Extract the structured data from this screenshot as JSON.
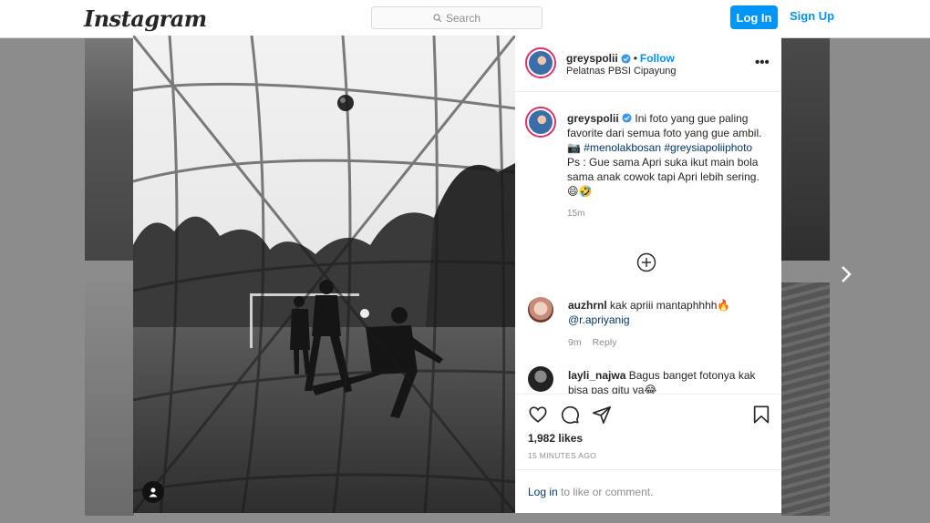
{
  "nav": {
    "logo": "Instagram",
    "search_placeholder": "Search",
    "login_label": "Log In",
    "signup_label": "Sign Up"
  },
  "post": {
    "username": "greyspolii",
    "follow_label": "Follow",
    "separator": "•",
    "location": "Pelatnas PBSI Cipayung",
    "more_label": "•••",
    "caption_text_1": "Ini foto yang gue paling favorite dari semua foto yang gue ambil. 📷",
    "hashtag_1": "#menolakbosan",
    "hashtag_2": "#greysiapoliiphoto",
    "caption_text_2": "Ps : Gue sama Apri suka ikut main bola sama anak cowok tapi Apri lebih sering. 😄🤣",
    "caption_time": "15m",
    "likes": "1,982 likes",
    "posted": "15 MINUTES AGO"
  },
  "comments": [
    {
      "username": "auzhrnl",
      "text": "kak apriii mantaphhhh🔥",
      "mention": "@r.apriyanig",
      "time": "9m",
      "reply_label": "Reply"
    },
    {
      "username": "layli_najwa",
      "text": "Bagus banget fotonya kak bisa pas gitu ya😂"
    }
  ],
  "footer": {
    "login_link": "Log in",
    "login_suffix": " to like or comment."
  },
  "colors": {
    "accent": "#0095f6",
    "link": "#00376b",
    "muted": "#8e8e8e"
  }
}
